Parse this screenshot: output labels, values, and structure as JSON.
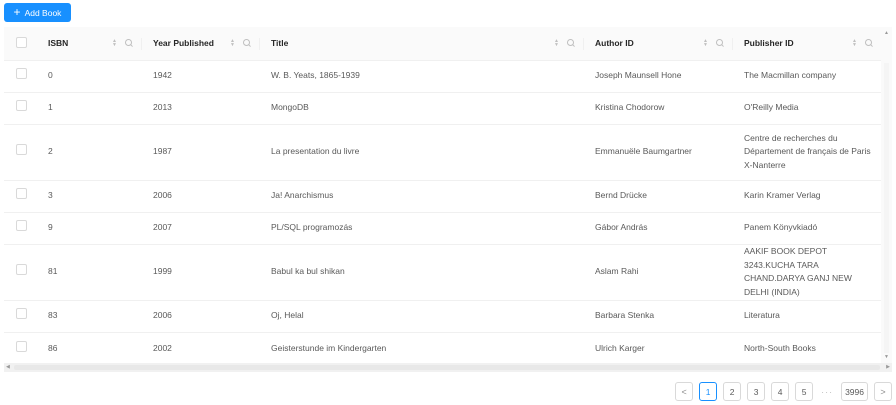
{
  "toolbar": {
    "add_label": "Add Book"
  },
  "columns": {
    "isbn": "ISBN",
    "year": "Year Published",
    "title": "Title",
    "author": "Author ID",
    "publisher": "Publisher ID"
  },
  "rows": [
    {
      "isbn": "0",
      "year": "1942",
      "title": "W. B. Yeats, 1865-1939",
      "author": "Joseph Maunsell Hone",
      "publisher": "The Macmillan company"
    },
    {
      "isbn": "1",
      "year": "2013",
      "title": "MongoDB",
      "author": "Kristina Chodorow",
      "publisher": "O'Reilly Media"
    },
    {
      "isbn": "2",
      "year": "1987",
      "title": "La presentation du livre",
      "author": "Emmanuële Baumgartner",
      "publisher": "Centre de recherches du Département de français de Paris X-Nanterre"
    },
    {
      "isbn": "3",
      "year": "2006",
      "title": "Ja! Anarchismus",
      "author": "Bernd Drücke",
      "publisher": "Karin Kramer Verlag"
    },
    {
      "isbn": "9",
      "year": "2007",
      "title": "PL/SQL programozás",
      "author": "Gábor András",
      "publisher": "Panem Könyvkiadó"
    },
    {
      "isbn": "81",
      "year": "1999",
      "title": "Babul ka bul shikan",
      "author": "Aslam Rahi",
      "publisher": "AAKIF BOOK DEPOT 3243.KUCHA TARA CHAND.DARYA GANJ NEW DELHI (INDIA)"
    },
    {
      "isbn": "83",
      "year": "2006",
      "title": "Oj, Helal",
      "author": "Barbara Stenka",
      "publisher": "Literatura"
    },
    {
      "isbn": "86",
      "year": "2002",
      "title": "Geisterstunde im Kindergarten",
      "author": "Ulrich Karger",
      "publisher": "North-South Books"
    }
  ],
  "pagination": {
    "prev": "<",
    "pages": [
      "1",
      "2",
      "3",
      "4",
      "5"
    ],
    "ellipsis": "···",
    "last": "3996",
    "next": ">",
    "current": "1"
  }
}
